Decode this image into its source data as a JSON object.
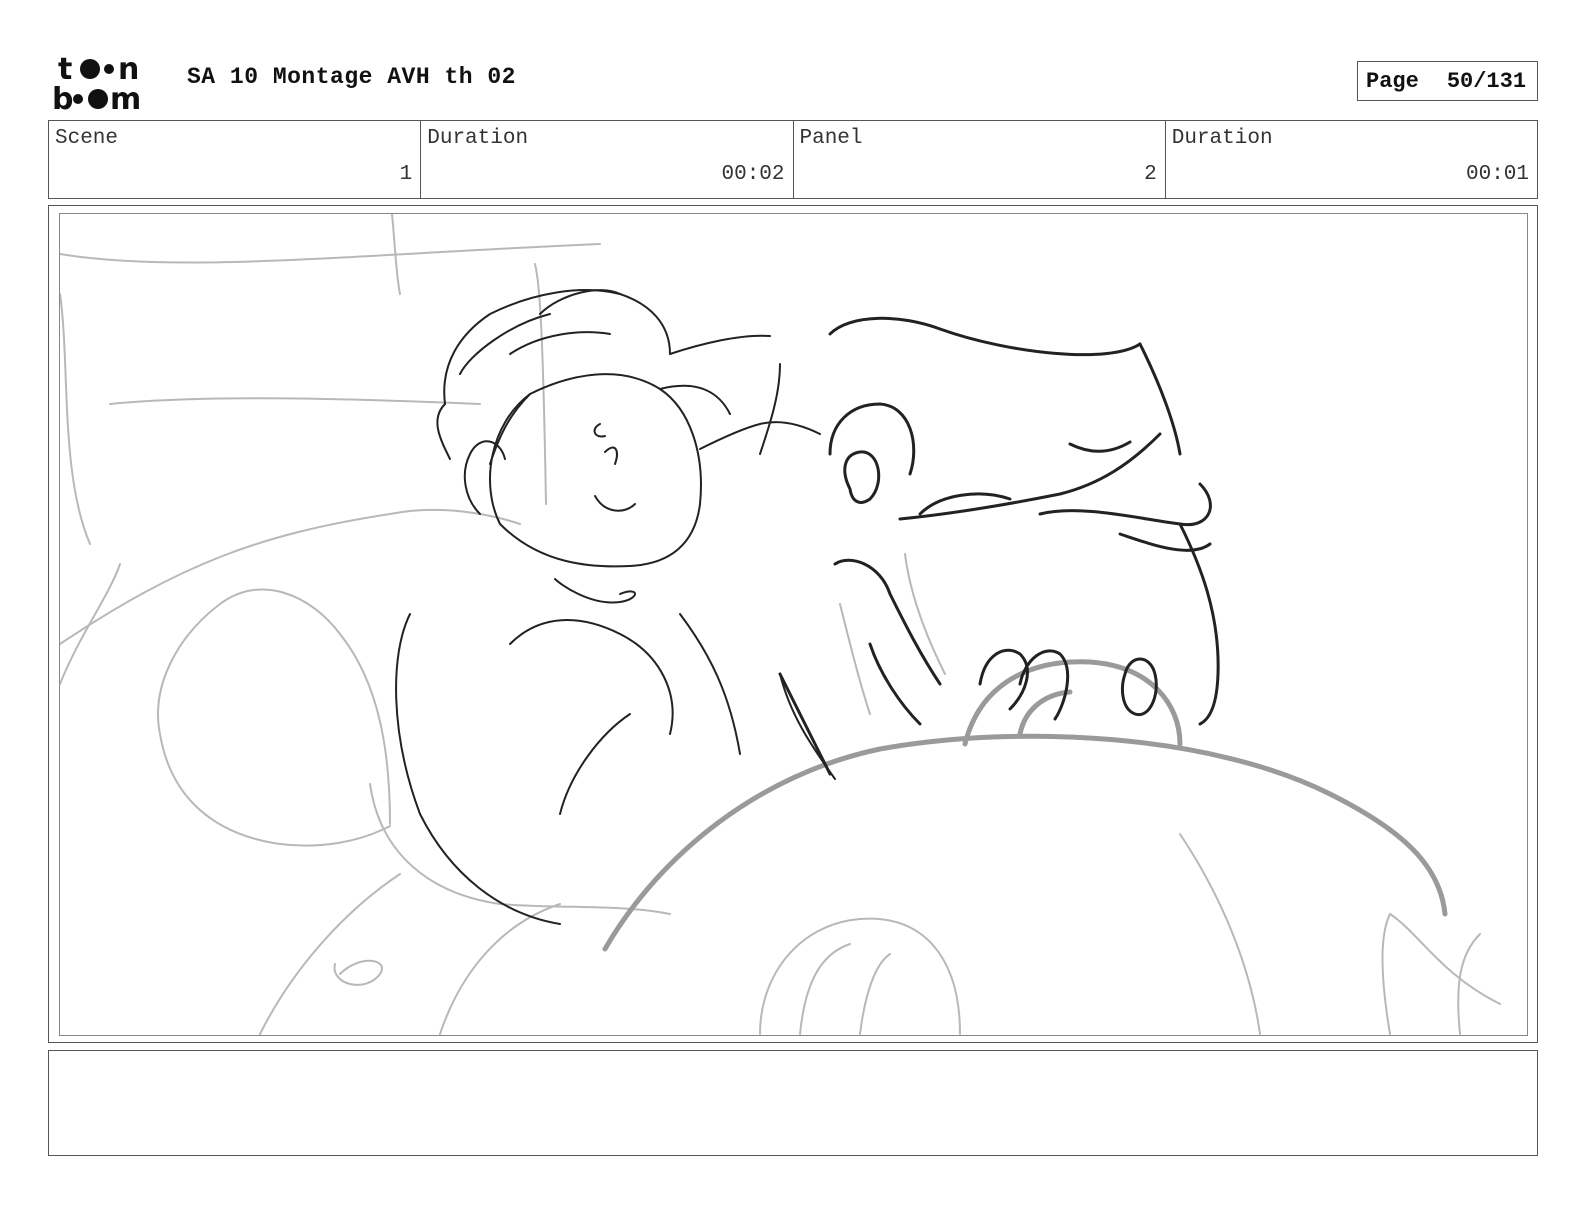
{
  "header": {
    "logo_text": "toonboom",
    "title": "SA 10 Montage AVH th 02",
    "page_label": "Page",
    "page_number": "50/131"
  },
  "info": {
    "scene_label": "Scene",
    "scene_value": "1",
    "scene_duration_label": "Duration",
    "scene_duration_value": "00:02",
    "panel_label": "Panel",
    "panel_value": "2",
    "panel_duration_label": "Duration",
    "panel_duration_value": "00:01"
  },
  "panel": {
    "image_icon": "storyboard-sketch"
  },
  "notes": {
    "text": ""
  }
}
